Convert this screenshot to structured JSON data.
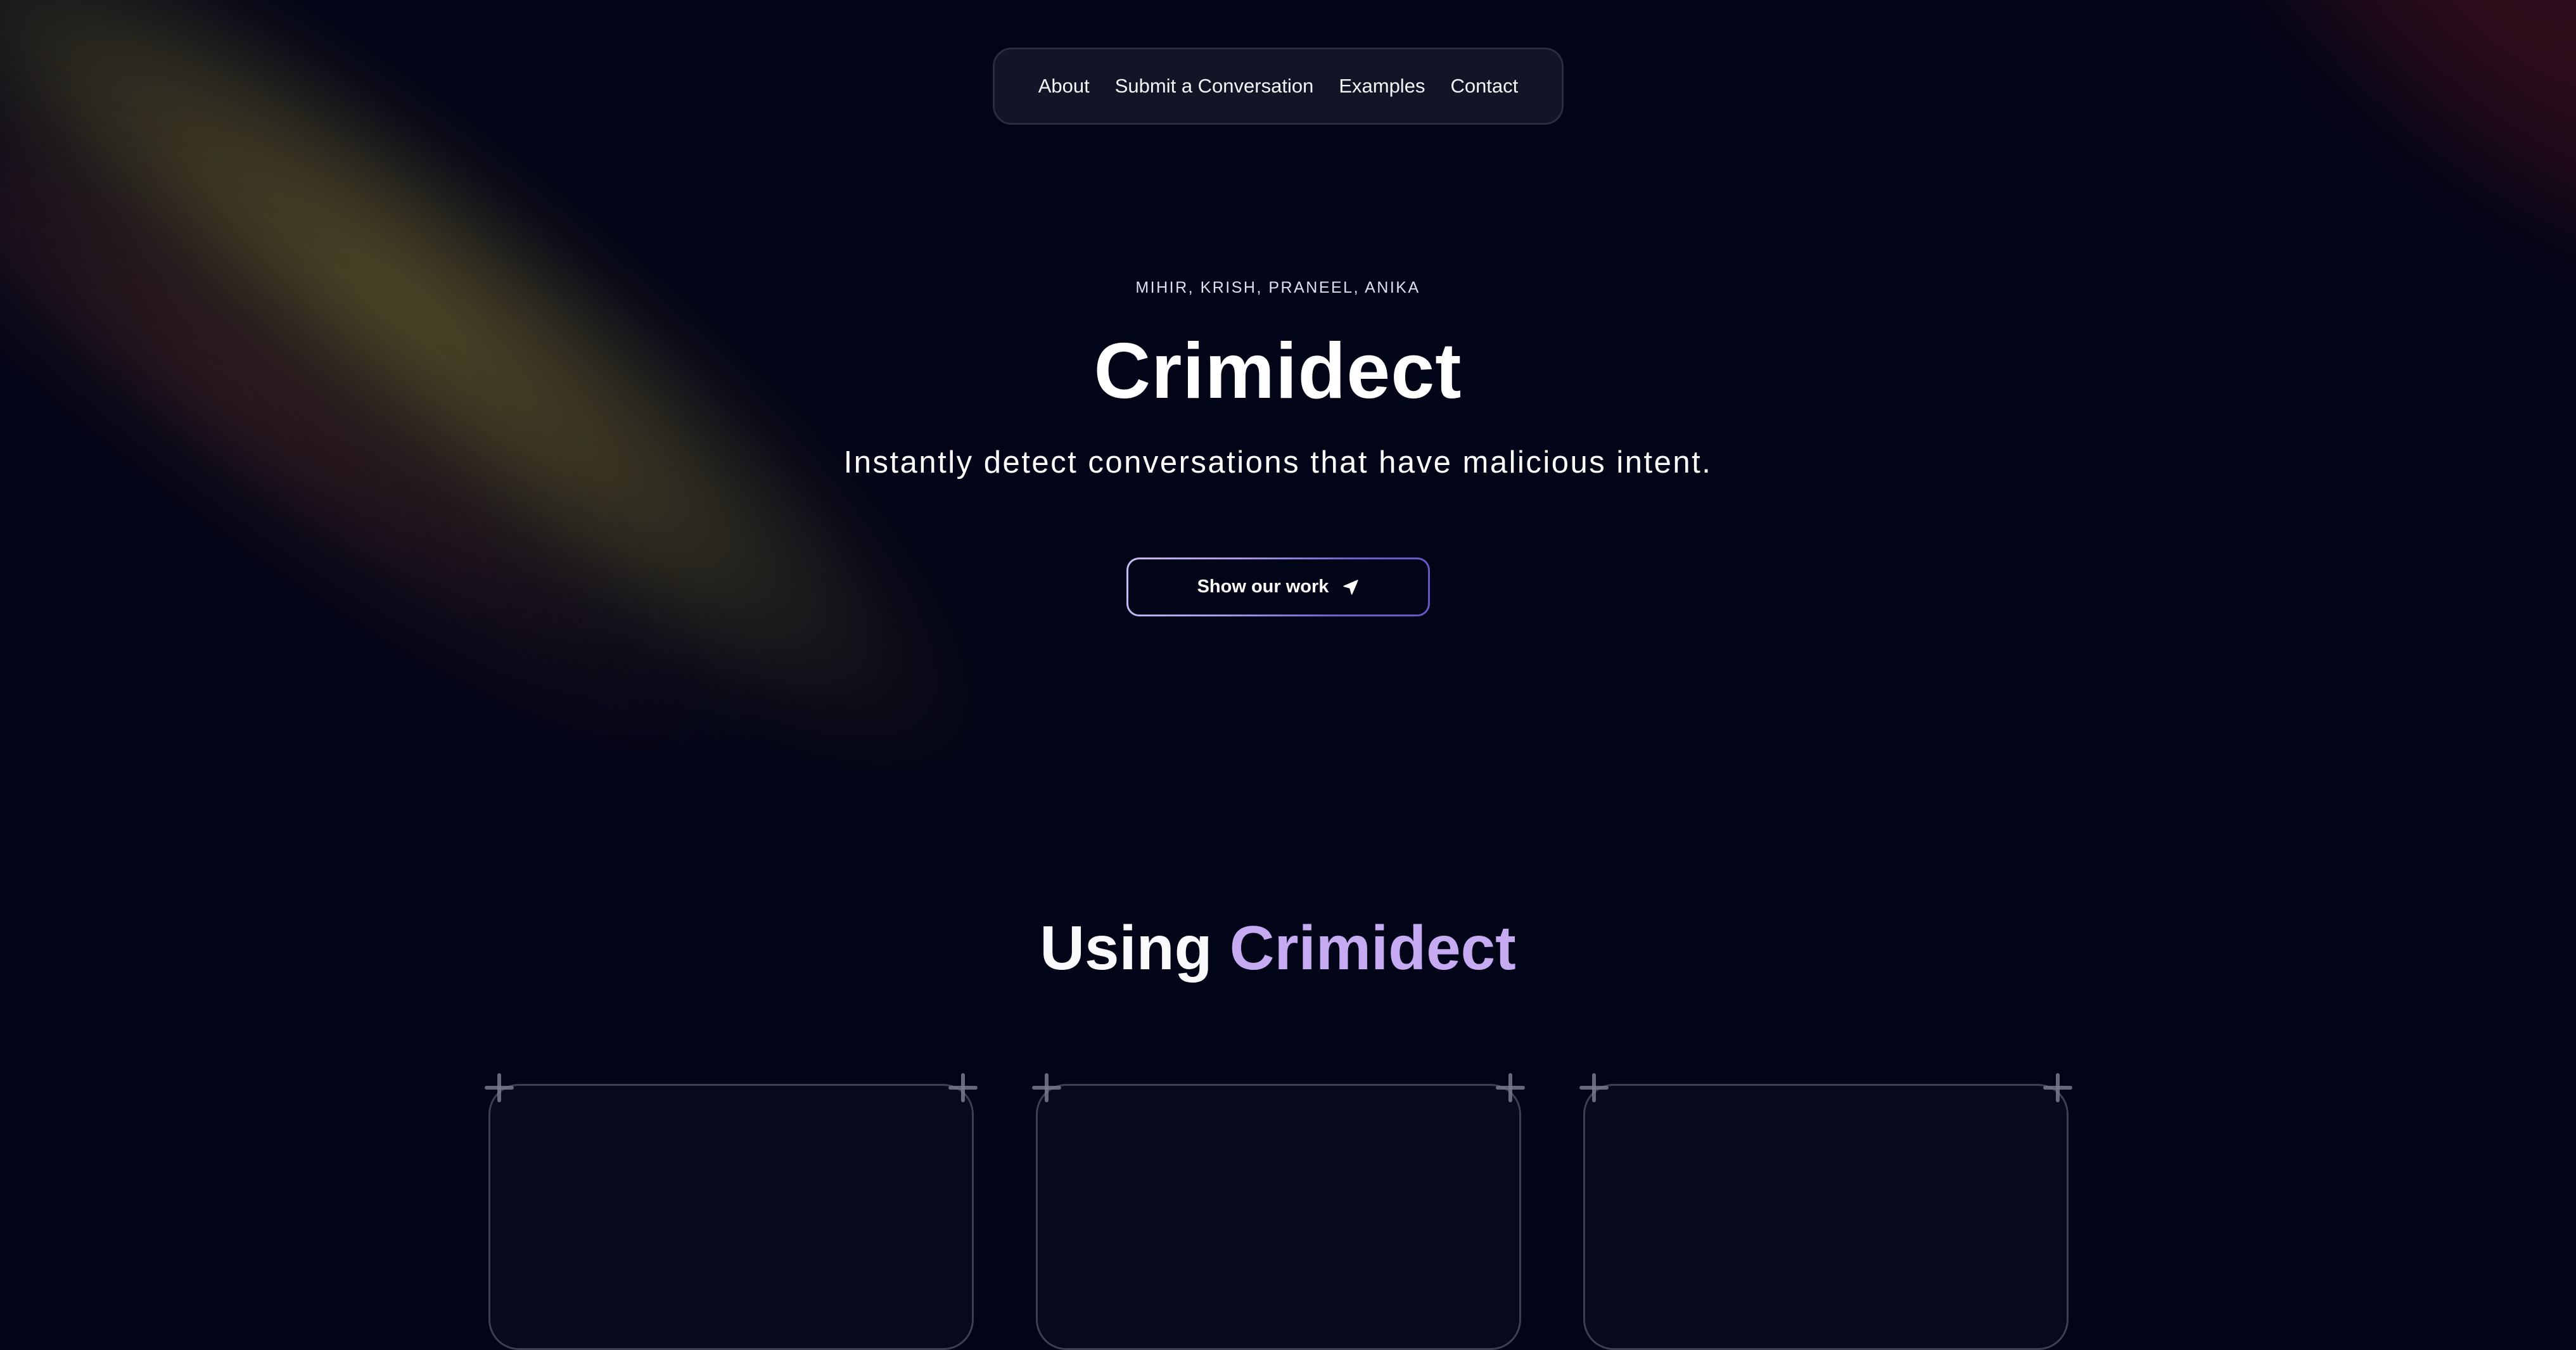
{
  "nav": {
    "links": [
      {
        "label": "About"
      },
      {
        "label": "Submit a Conversation"
      },
      {
        "label": "Examples"
      },
      {
        "label": "Contact"
      }
    ]
  },
  "hero": {
    "authors": "MIHIR, KRISH, PRANEEL, ANIKA",
    "title": "Crimidect",
    "subtitle": "Instantly detect conversations that have malicious intent.",
    "cta": {
      "label": "Show our work",
      "icon": "navigation-arrow-icon"
    }
  },
  "section": {
    "title_prefix": "Using ",
    "title_accent": "Crimidect"
  },
  "cards": [
    {
      "corner_icon": "plus-icon"
    },
    {
      "corner_icon": "plus-icon"
    },
    {
      "corner_icon": "plus-icon"
    }
  ],
  "colors": {
    "background": "#020417",
    "accent": "#c6abf3",
    "nav_background": "#111526",
    "button_border_start": "#cbbcf2",
    "button_border_end": "#6358c4",
    "glow_olive": "#564e28",
    "glow_red": "#380e1c"
  }
}
